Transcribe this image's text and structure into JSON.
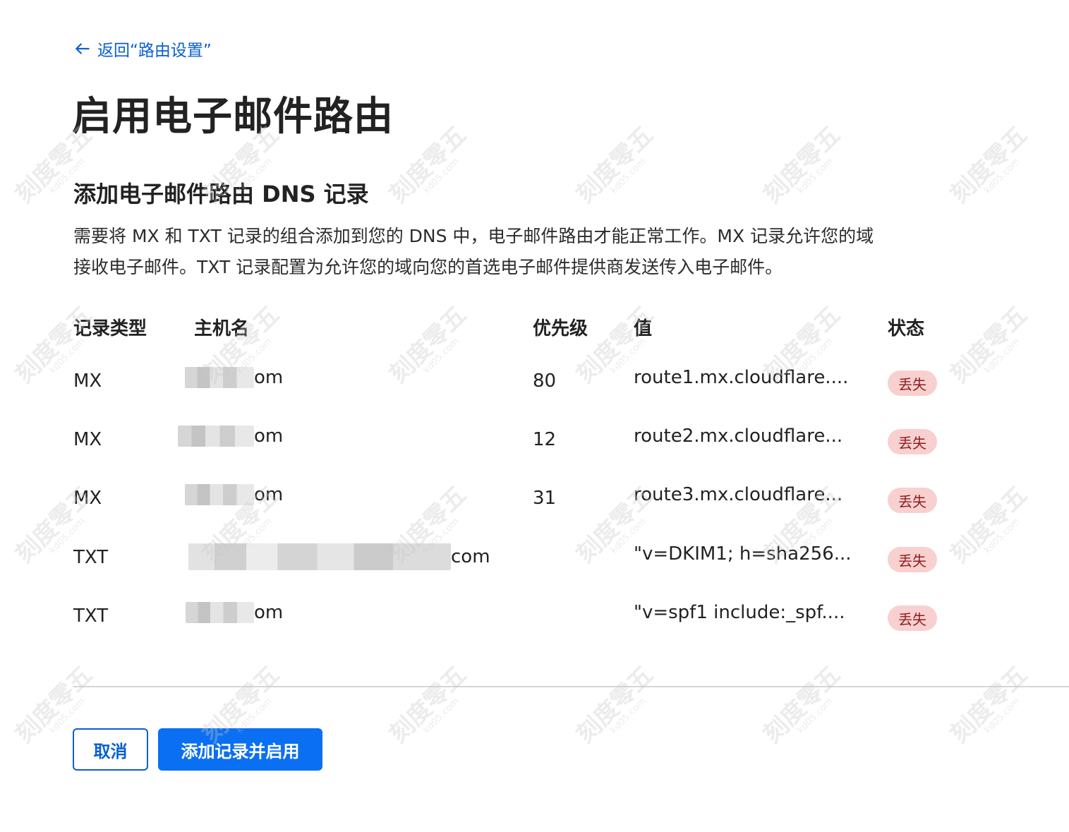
{
  "back_link": {
    "label": "返回“路由设置”"
  },
  "page_title": "启用电子邮件路由",
  "section": {
    "title": "添加电子邮件路由 DNS 记录",
    "description_line1": "需要将 MX 和 TXT 记录的组合添加到您的 DNS 中，电子邮件路由才能正常工作。MX 记录允许您的域",
    "description_line2": "接收电子邮件。TXT 记录配置为允许您的域向您的首选电子邮件提供商发送传入电子邮件。"
  },
  "table": {
    "headers": {
      "type": "记录类型",
      "host": "主机名",
      "priority": "优先级",
      "value": "值",
      "status": "状态"
    },
    "rows": [
      {
        "type": "MX",
        "host_suffix": "om",
        "priority": "80",
        "value": "route1.mx.cloudflare....",
        "status": "丢失"
      },
      {
        "type": "MX",
        "host_suffix": "om",
        "priority": "12",
        "value": "route2.mx.cloudflare...",
        "status": "丢失"
      },
      {
        "type": "MX",
        "host_suffix": "om",
        "priority": "31",
        "value": "route3.mx.cloudflare...",
        "status": "丢失"
      },
      {
        "type": "TXT",
        "host_suffix": "com",
        "priority": "",
        "value": "\"v=DKIM1; h=sha256...",
        "status": "丢失"
      },
      {
        "type": "TXT",
        "host_suffix": "om",
        "priority": "",
        "value": "\"v=spf1 include:_spf....",
        "status": "丢失"
      }
    ]
  },
  "buttons": {
    "cancel": "取消",
    "primary": "添加记录并启用"
  },
  "watermark": {
    "text": "刻度零五",
    "sub": "kd05.com"
  },
  "colors": {
    "accent": "#0a6ff2",
    "link": "#0b5fd1",
    "badge_bg": "#f8d0d0",
    "badge_text": "#8d1d1d"
  }
}
